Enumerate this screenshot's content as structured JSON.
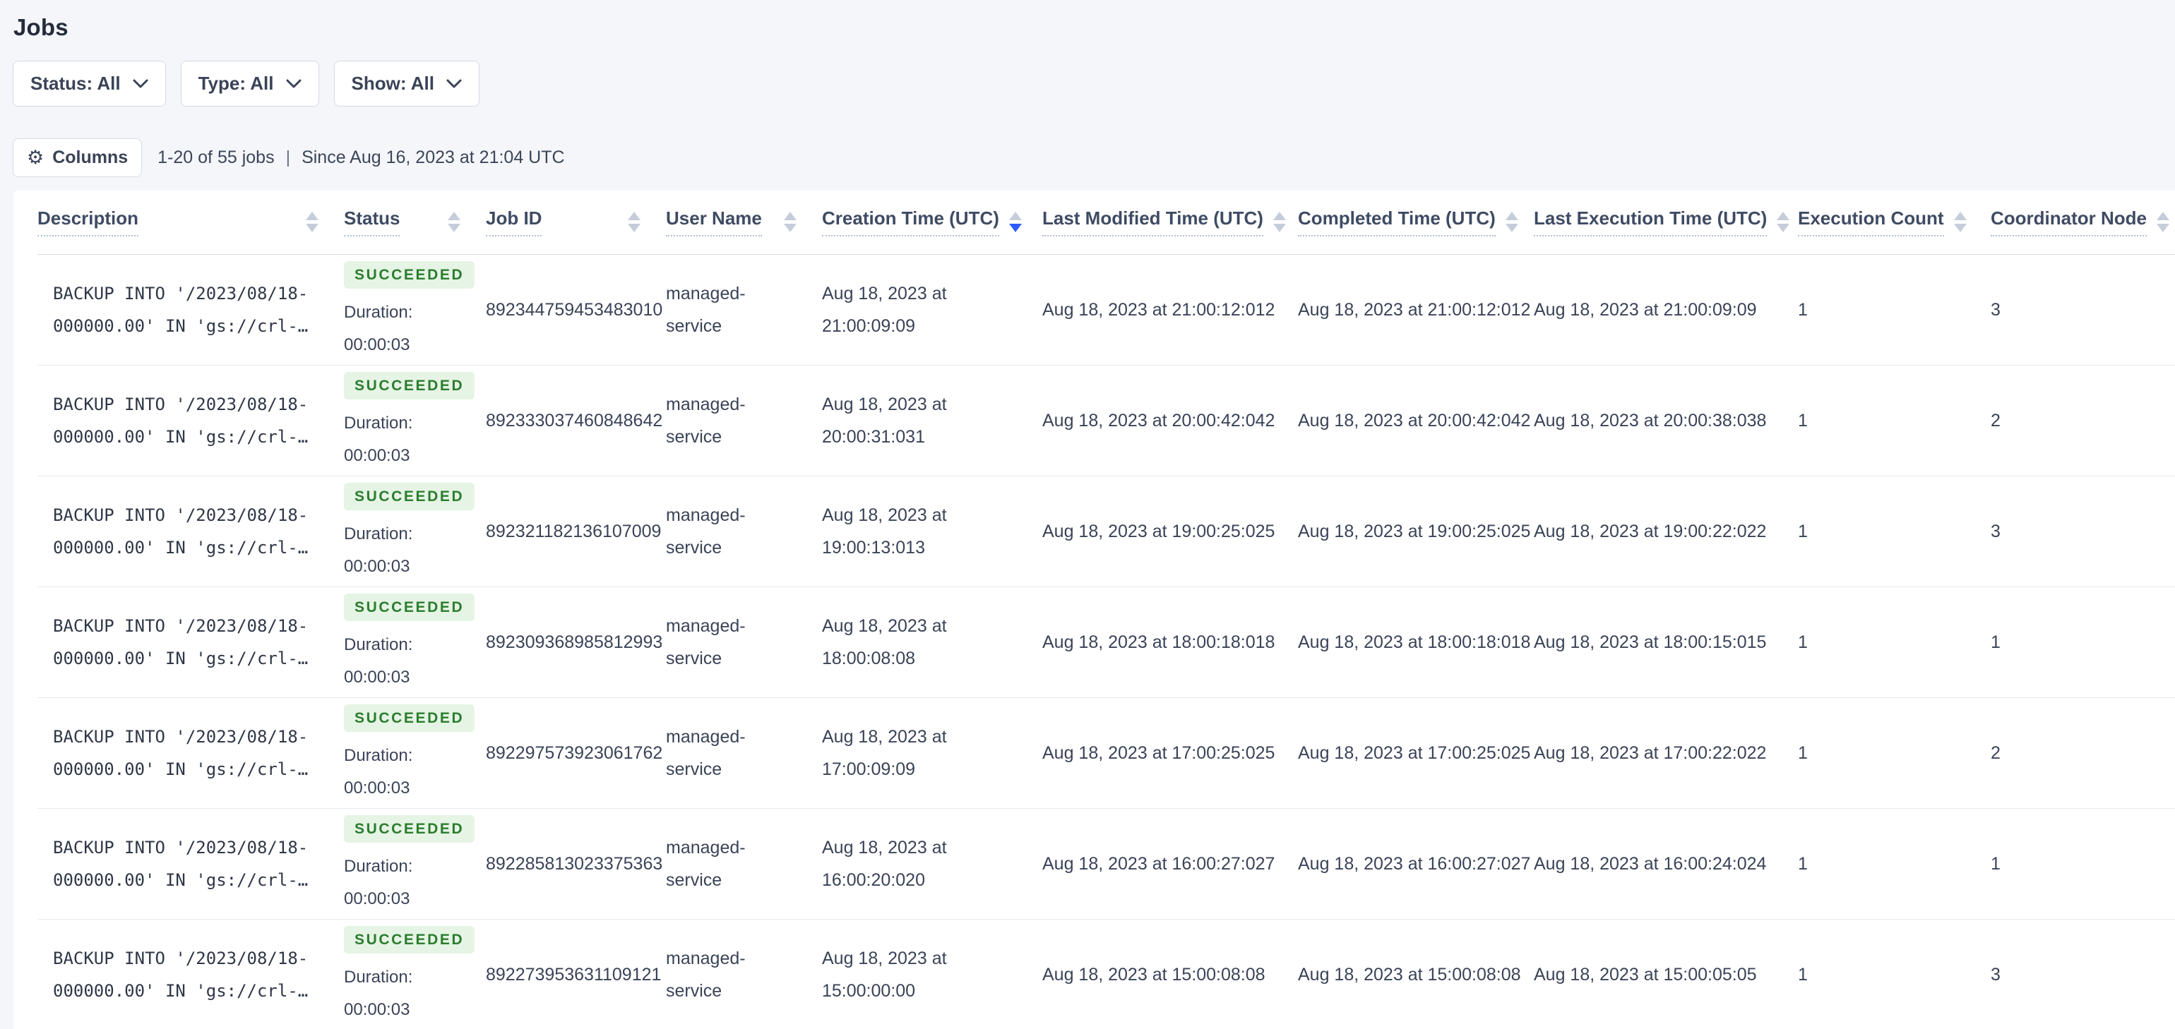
{
  "page": {
    "title": "Jobs"
  },
  "colors": {
    "accent_sort_blue": "#2d5bff",
    "badge_background": "#e5f4e4",
    "badge_text": "#2b7d2f",
    "page_background": "#f4f6fa",
    "card_background": "#ffffff"
  },
  "filters": [
    {
      "label": "Status: All"
    },
    {
      "label": "Type: All"
    },
    {
      "label": "Show: All"
    }
  ],
  "toolbar": {
    "columns_label": "Columns",
    "gear_icon": "gear-icon",
    "jobs_count": "1-20 of 55 jobs",
    "separator": "|",
    "since_text": "Since Aug 16, 2023 at 21:04 UTC"
  },
  "table": {
    "columns": [
      {
        "label": "Description",
        "sorted": "none"
      },
      {
        "label": "Status",
        "sorted": "none"
      },
      {
        "label": "Job ID",
        "sorted": "none"
      },
      {
        "label": "User Name",
        "sorted": "none"
      },
      {
        "label": "Creation Time (UTC)",
        "sorted": "desc"
      },
      {
        "label": "Last Modified Time (UTC)",
        "sorted": "none"
      },
      {
        "label": "Completed Time (UTC)",
        "sorted": "none"
      },
      {
        "label": "Last Execution Time (UTC)",
        "sorted": "none"
      },
      {
        "label": "Execution Count",
        "sorted": "none"
      },
      {
        "label": "Coordinator Node",
        "sorted": "none"
      }
    ],
    "rows": [
      {
        "description": "BACKUP INTO '/2023/08/18-000000.00' IN 'gs://crl-…",
        "status": "SUCCEEDED",
        "duration_label": "Duration:",
        "duration_value": "00:00:03",
        "job_id": "892344759453483010",
        "user_name": "managed-service",
        "creation_time": "Aug 18, 2023 at 21:00:09:09",
        "last_modified_time": "Aug 18, 2023 at 21:00:12:012",
        "completed_time": "Aug 18, 2023 at 21:00:12:012",
        "last_execution_time": "Aug 18, 2023 at 21:00:09:09",
        "execution_count": "1",
        "coordinator_node": "3"
      },
      {
        "description": "BACKUP INTO '/2023/08/18-000000.00' IN 'gs://crl-…",
        "status": "SUCCEEDED",
        "duration_label": "Duration:",
        "duration_value": "00:00:03",
        "job_id": "892333037460848642",
        "user_name": "managed-service",
        "creation_time": "Aug 18, 2023 at 20:00:31:031",
        "last_modified_time": "Aug 18, 2023 at 20:00:42:042",
        "completed_time": "Aug 18, 2023 at 20:00:42:042",
        "last_execution_time": "Aug 18, 2023 at 20:00:38:038",
        "execution_count": "1",
        "coordinator_node": "2"
      },
      {
        "description": "BACKUP INTO '/2023/08/18-000000.00' IN 'gs://crl-…",
        "status": "SUCCEEDED",
        "duration_label": "Duration:",
        "duration_value": "00:00:03",
        "job_id": "892321182136107009",
        "user_name": "managed-service",
        "creation_time": "Aug 18, 2023 at 19:00:13:013",
        "last_modified_time": "Aug 18, 2023 at 19:00:25:025",
        "completed_time": "Aug 18, 2023 at 19:00:25:025",
        "last_execution_time": "Aug 18, 2023 at 19:00:22:022",
        "execution_count": "1",
        "coordinator_node": "3"
      },
      {
        "description": "BACKUP INTO '/2023/08/18-000000.00' IN 'gs://crl-…",
        "status": "SUCCEEDED",
        "duration_label": "Duration:",
        "duration_value": "00:00:03",
        "job_id": "892309368985812993",
        "user_name": "managed-service",
        "creation_time": "Aug 18, 2023 at 18:00:08:08",
        "last_modified_time": "Aug 18, 2023 at 18:00:18:018",
        "completed_time": "Aug 18, 2023 at 18:00:18:018",
        "last_execution_time": "Aug 18, 2023 at 18:00:15:015",
        "execution_count": "1",
        "coordinator_node": "1"
      },
      {
        "description": "BACKUP INTO '/2023/08/18-000000.00' IN 'gs://crl-…",
        "status": "SUCCEEDED",
        "duration_label": "Duration:",
        "duration_value": "00:00:03",
        "job_id": "892297573923061762",
        "user_name": "managed-service",
        "creation_time": "Aug 18, 2023 at 17:00:09:09",
        "last_modified_time": "Aug 18, 2023 at 17:00:25:025",
        "completed_time": "Aug 18, 2023 at 17:00:25:025",
        "last_execution_time": "Aug 18, 2023 at 17:00:22:022",
        "execution_count": "1",
        "coordinator_node": "2"
      },
      {
        "description": "BACKUP INTO '/2023/08/18-000000.00' IN 'gs://crl-…",
        "status": "SUCCEEDED",
        "duration_label": "Duration:",
        "duration_value": "00:00:03",
        "job_id": "892285813023375363",
        "user_name": "managed-service",
        "creation_time": "Aug 18, 2023 at 16:00:20:020",
        "last_modified_time": "Aug 18, 2023 at 16:00:27:027",
        "completed_time": "Aug 18, 2023 at 16:00:27:027",
        "last_execution_time": "Aug 18, 2023 at 16:00:24:024",
        "execution_count": "1",
        "coordinator_node": "1"
      },
      {
        "description": "BACKUP INTO '/2023/08/18-000000.00' IN 'gs://crl-…",
        "status": "SUCCEEDED",
        "duration_label": "Duration:",
        "duration_value": "00:00:03",
        "job_id": "892273953631109121",
        "user_name": "managed-service",
        "creation_time": "Aug 18, 2023 at 15:00:00:00",
        "last_modified_time": "Aug 18, 2023 at 15:00:08:08",
        "completed_time": "Aug 18, 2023 at 15:00:08:08",
        "last_execution_time": "Aug 18, 2023 at 15:00:05:05",
        "execution_count": "1",
        "coordinator_node": "3"
      }
    ]
  }
}
